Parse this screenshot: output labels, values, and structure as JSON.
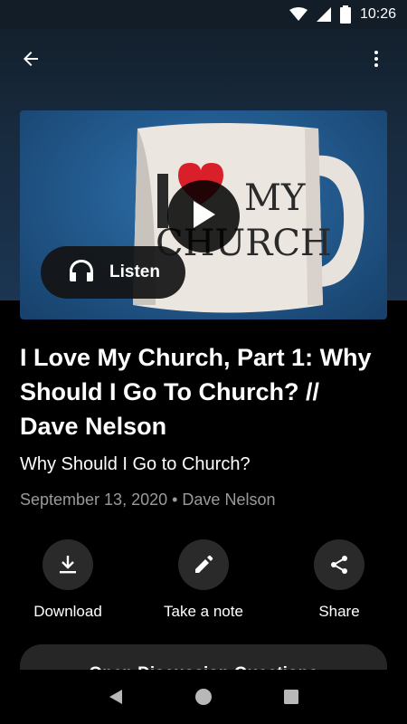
{
  "status_bar": {
    "time": "10:26",
    "icons": [
      "wifi-icon",
      "cellular-signal-icon",
      "battery-icon"
    ]
  },
  "app_bar": {
    "back_icon": "back-arrow-icon",
    "menu_icon": "more-vert-icon"
  },
  "media": {
    "thumbnail_text_line1": "MY",
    "thumbnail_text_line2": "CHURCH",
    "play_icon": "play-icon",
    "listen_label": "Listen",
    "listen_icon": "headphones-icon"
  },
  "content": {
    "title": "I Love My Church, Part 1: Why Should I Go To Church? // Dave Nelson",
    "subtitle": "Why Should I Go to Church?",
    "meta": "September 13, 2020 • Dave Nelson"
  },
  "actions": [
    {
      "label": "Download",
      "icon": "download-icon"
    },
    {
      "label": "Take a note",
      "icon": "pencil-icon"
    },
    {
      "label": "Share",
      "icon": "share-icon"
    }
  ],
  "bottom_card": {
    "label": "Open Discussion Questions"
  },
  "colors": {
    "background": "#000000",
    "hero": "#182b3f",
    "action_circle": "#2a2a2a",
    "meta_text": "#9a9a9a"
  }
}
